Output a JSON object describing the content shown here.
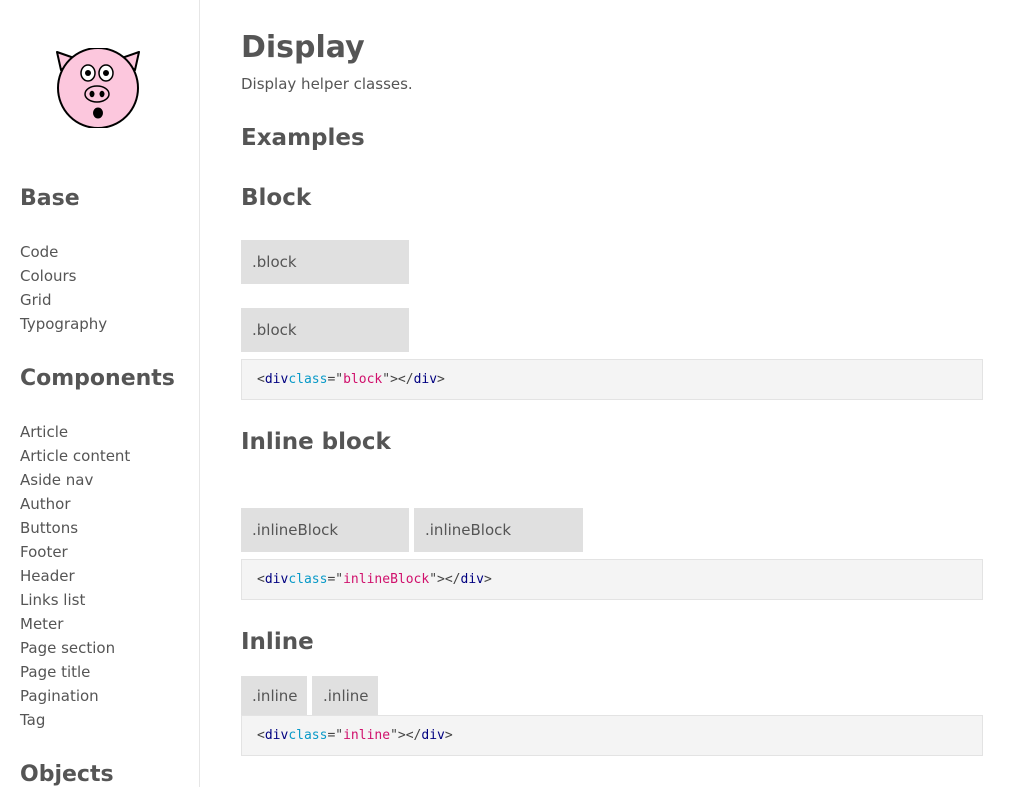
{
  "sidebar": {
    "sections": [
      {
        "title": "Base",
        "items": [
          "Code",
          "Colours",
          "Grid",
          "Typography"
        ]
      },
      {
        "title": "Components",
        "items": [
          "Article",
          "Article content",
          "Aside nav",
          "Author",
          "Buttons",
          "Footer",
          "Header",
          "Links list",
          "Meter",
          "Page section",
          "Page title",
          "Pagination",
          "Tag"
        ]
      },
      {
        "title": "Objects",
        "items": []
      }
    ]
  },
  "page": {
    "title": "Display",
    "description": "Display helper classes.",
    "examples_heading": "Examples"
  },
  "block": {
    "heading": "Block",
    "demo1": ".block",
    "demo2": ".block",
    "code": {
      "lt": "<",
      "tag": "div",
      "attr": "class",
      "eq": "=",
      "quote": "\"",
      "value": "block",
      "close": "></",
      "tag_close": "div",
      "gt": ">"
    }
  },
  "inline_block": {
    "heading": "Inline block",
    "demo1": ".inlineBlock",
    "demo2": ".inlineBlock",
    "code": {
      "lt": "<",
      "tag": "div",
      "attr": "class",
      "eq": "=",
      "quote": "\"",
      "value": "inlineBlock",
      "close": "></",
      "tag_close": "div",
      "gt": ">"
    }
  },
  "inline": {
    "heading": "Inline",
    "demo1": ".inline",
    "demo2": ".inline",
    "code": {
      "lt": "<",
      "tag": "div",
      "attr": "class",
      "eq": "=",
      "quote": "\"",
      "value": "inline",
      "close": "></",
      "tag_close": "div",
      "gt": ">"
    }
  },
  "colors": {
    "demo_bg": "#e0e0e0",
    "code_bg": "#f4f4f4",
    "code_tag": "#000080",
    "code_attr": "#0a9ac8",
    "code_value": "#d0106c",
    "logo_pink": "#fcc7dd"
  },
  "icons": {
    "logo": "pig-face-icon"
  }
}
